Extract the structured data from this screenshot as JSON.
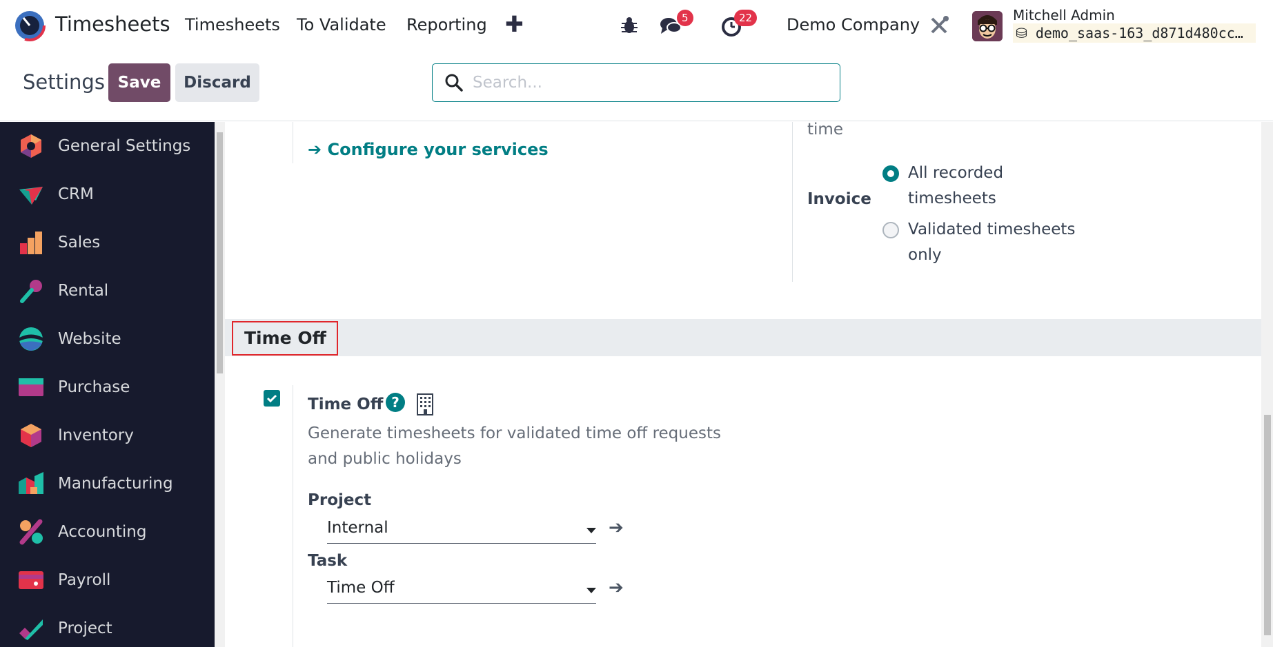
{
  "navbar": {
    "app_name": "Timesheets",
    "menu": [
      "Timesheets",
      "To Validate",
      "Reporting"
    ],
    "plus": "✚",
    "messages_badge": "5",
    "activities_badge": "22",
    "company": "Demo Company",
    "user_name": "Mitchell Admin",
    "database": "demo_saas-163_d871d480cc…"
  },
  "control_panel": {
    "title": "Settings",
    "save_label": "Save",
    "discard_label": "Discard",
    "search_placeholder": "Search..."
  },
  "sidebar": {
    "items": [
      {
        "label": "General Settings",
        "icon": "general-settings-icon"
      },
      {
        "label": "CRM",
        "icon": "crm-icon"
      },
      {
        "label": "Sales",
        "icon": "sales-icon"
      },
      {
        "label": "Rental",
        "icon": "rental-icon"
      },
      {
        "label": "Website",
        "icon": "website-icon"
      },
      {
        "label": "Purchase",
        "icon": "purchase-icon"
      },
      {
        "label": "Inventory",
        "icon": "inventory-icon"
      },
      {
        "label": "Manufacturing",
        "icon": "manufacturing-icon"
      },
      {
        "label": "Accounting",
        "icon": "accounting-icon"
      },
      {
        "label": "Payroll",
        "icon": "payroll-icon"
      },
      {
        "label": "Project",
        "icon": "project-icon"
      }
    ]
  },
  "content": {
    "configure_link": "➔ Configure your services",
    "time_fragment": "time",
    "invoice_label": "Invoice",
    "invoice_options": [
      {
        "line1": "All recorded",
        "line2": "timesheets",
        "checked": true
      },
      {
        "line1": "Validated timesheets",
        "line2": "only",
        "checked": false
      }
    ],
    "section_title": "Time Off",
    "time_off": {
      "title": "Time Off",
      "help": "?",
      "checked": true,
      "desc_line1": "Generate timesheets for validated time off requests",
      "desc_line2": "and public holidays",
      "project_label": "Project",
      "project_value": "Internal",
      "task_label": "Task",
      "task_value": "Time Off",
      "arrow": "➔"
    }
  },
  "colors": {
    "accent": "#017e84",
    "primary": "#714b67",
    "sidebar_bg": "#171a2d",
    "badge": "#e2334a",
    "highlight_border": "#e0262b"
  }
}
